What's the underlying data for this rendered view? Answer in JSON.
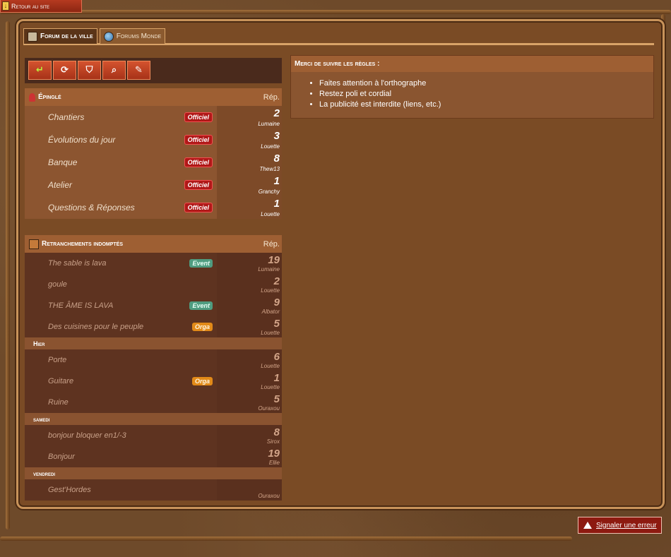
{
  "back_link": {
    "label": "Retour au site"
  },
  "tabs": [
    {
      "label": "Forum de la ville",
      "active": true
    },
    {
      "label": "Forums Monde",
      "active": false
    }
  ],
  "toolbar": {
    "buttons": [
      {
        "icon": "return-arrow-icon",
        "glyph": "↵"
      },
      {
        "icon": "refresh-icon",
        "glyph": "⟳"
      },
      {
        "icon": "filter-icon",
        "glyph": "⛉"
      },
      {
        "icon": "search-icon",
        "glyph": "⌕"
      },
      {
        "icon": "pencil-icon",
        "glyph": "✎"
      }
    ]
  },
  "pinned": {
    "title": "Épinglé",
    "rep_label": "Rép.",
    "threads": [
      {
        "title": "Chantiers",
        "badge": "Officiel",
        "replies": "2",
        "user": "Lumaine"
      },
      {
        "title": "Évolutions du jour",
        "badge": "Officiel",
        "replies": "3",
        "user": "Louette"
      },
      {
        "title": "Banque",
        "badge": "Officiel",
        "replies": "8",
        "user": "Thew13"
      },
      {
        "title": "Atelier",
        "badge": "Officiel",
        "replies": "1",
        "user": "Granchy"
      },
      {
        "title": "Questions & Réponses",
        "badge": "Officiel",
        "replies": "1",
        "user": "Louette"
      }
    ]
  },
  "forum": {
    "title": "Retranchements indomptés",
    "rep_label": "Rép.",
    "groups": [
      {
        "label": "",
        "threads": [
          {
            "title": "The sable is lava",
            "badge": "Event",
            "badge_type": "event",
            "replies": "19",
            "user": "Lumaine"
          },
          {
            "title": "goule",
            "badge": "",
            "badge_type": "",
            "replies": "2",
            "user": "Louette"
          },
          {
            "title": "THE ÂME IS LAVA",
            "badge": "Event",
            "badge_type": "event",
            "replies": "9",
            "user": "Albator"
          },
          {
            "title": "Des cuisines pour le peuple",
            "badge": "Orga",
            "badge_type": "orga",
            "replies": "5",
            "user": "Louette"
          }
        ]
      },
      {
        "label": "Hier",
        "threads": [
          {
            "title": "Porte",
            "badge": "",
            "badge_type": "",
            "replies": "6",
            "user": "Louette"
          },
          {
            "title": "Guitare",
            "badge": "Orga",
            "badge_type": "orga",
            "replies": "1",
            "user": "Louette"
          },
          {
            "title": "Ruine",
            "badge": "",
            "badge_type": "",
            "replies": "5",
            "user": "Ouraxou"
          }
        ]
      },
      {
        "label": "samedi",
        "threads": [
          {
            "title": "bonjour bloquer en1/-3",
            "badge": "",
            "badge_type": "",
            "replies": "8",
            "user": "Sirox"
          },
          {
            "title": "Bonjour",
            "badge": "",
            "badge_type": "",
            "replies": "19",
            "user": "Ellie"
          }
        ]
      },
      {
        "label": "vendredi",
        "threads": [
          {
            "title": "Gest'Hordes",
            "badge": "",
            "badge_type": "",
            "replies": "",
            "user": "Ouraxou"
          }
        ]
      }
    ]
  },
  "rules": {
    "title": "Merci de suivre les règles :",
    "items": [
      "Faites attention à l'orthographe",
      "Restez poli et cordial",
      "La publicité est interdite (liens, etc.)"
    ]
  },
  "report": {
    "label": "Signaler une erreur"
  }
}
